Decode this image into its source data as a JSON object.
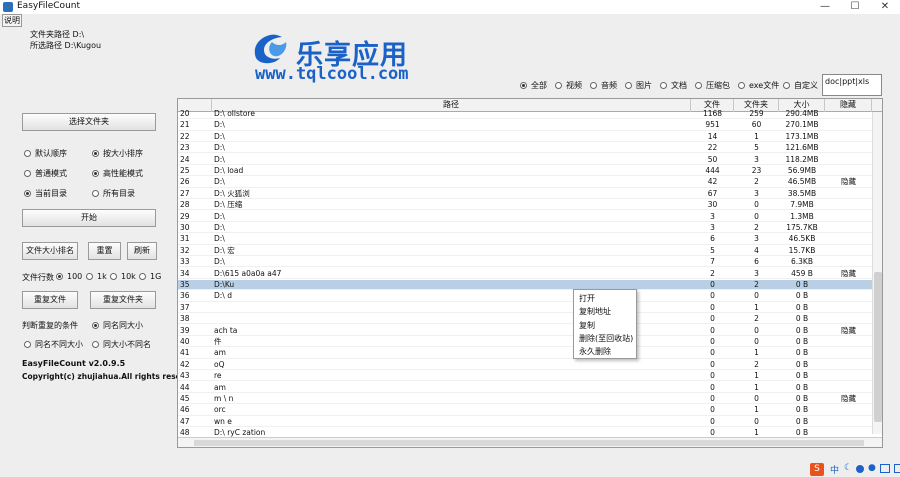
{
  "window": {
    "title": "EasyFileCount",
    "minimize": "—",
    "maximize": "☐",
    "close": "✕"
  },
  "help_button": "说明",
  "info": {
    "folder_path": "文件夹路径 D:\\",
    "selected_path": "所选路径 D:\\Kugou"
  },
  "watermark": {
    "name": "乐享应用",
    "url": "www.tqlcool.com"
  },
  "filters": {
    "options": [
      "全部",
      "视频",
      "音频",
      "图片",
      "文档",
      "压缩包",
      "exe文件",
      "自定义"
    ],
    "selected": "全部",
    "custom_ext": "doc|ppt|xls"
  },
  "left": {
    "select_folder": "选择文件夹",
    "sort_options": [
      "默认顺序",
      "按大小排序"
    ],
    "sort_selected": "按大小排序",
    "mode_options": [
      "普通模式",
      "高性能模式"
    ],
    "mode_selected": "高性能模式",
    "dir_options": [
      "当前目录",
      "所有目录"
    ],
    "dir_selected": "当前目录",
    "start": "开始",
    "rank": "文件大小排名",
    "reset": "重置",
    "refresh": "刷新",
    "rows_label": "文件行数",
    "rows_options": [
      "100",
      "1k",
      "10k",
      "1G"
    ],
    "rows_selected": "100",
    "dup_files": "重复文件",
    "dup_folders": "重复文件夹",
    "dup_cond_label": "判断重复的条件",
    "dup_options": [
      "同名同大小",
      "同名不同大小",
      "同大小不同名"
    ],
    "dup_selected": "同名同大小",
    "version": "EasyFileCount v2.0.9.5",
    "copyright": "Copyright(c) zhujiahua.All rights reserved."
  },
  "table": {
    "columns": [
      "",
      "路径",
      "文件",
      "文件夹",
      "大小",
      "隐藏"
    ],
    "rows": [
      {
        "n": "20",
        "path": "D:\\     ollstore",
        "files": "1168",
        "folders": "259",
        "size": "290.4MB",
        "hidden": ""
      },
      {
        "n": "21",
        "path": "D:\\",
        "files": "951",
        "folders": "60",
        "size": "270.1MB",
        "hidden": ""
      },
      {
        "n": "22",
        "path": "D:\\",
        "files": "14",
        "folders": "1",
        "size": "173.1MB",
        "hidden": ""
      },
      {
        "n": "23",
        "path": "D:\\",
        "files": "22",
        "folders": "5",
        "size": "121.6MB",
        "hidden": ""
      },
      {
        "n": "24",
        "path": "D:\\",
        "files": "50",
        "folders": "3",
        "size": "118.2MB",
        "hidden": ""
      },
      {
        "n": "25",
        "path": "D:\\                  load",
        "files": "444",
        "folders": "23",
        "size": "56.9MB",
        "hidden": ""
      },
      {
        "n": "26",
        "path": "D:\\",
        "files": "42",
        "folders": "2",
        "size": "46.5MB",
        "hidden": "隐藏"
      },
      {
        "n": "27",
        "path": "D:\\          火狐浏",
        "files": "67",
        "folders": "3",
        "size": "38.5MB",
        "hidden": ""
      },
      {
        "n": "28",
        "path": "D:\\          压缩",
        "files": "30",
        "folders": "0",
        "size": "7.9MB",
        "hidden": ""
      },
      {
        "n": "29",
        "path": "D:\\",
        "files": "3",
        "folders": "0",
        "size": "1.3MB",
        "hidden": ""
      },
      {
        "n": "30",
        "path": "D:\\",
        "files": "3",
        "folders": "2",
        "size": "175.7KB",
        "hidden": ""
      },
      {
        "n": "31",
        "path": "D:\\",
        "files": "6",
        "folders": "3",
        "size": "46.5KB",
        "hidden": ""
      },
      {
        "n": "32",
        "path": "D:\\          宏",
        "files": "5",
        "folders": "4",
        "size": "15.7KB",
        "hidden": ""
      },
      {
        "n": "33",
        "path": "D:\\",
        "files": "7",
        "folders": "6",
        "size": "6.3KB",
        "hidden": ""
      },
      {
        "n": "34",
        "path": "D:\\615        a0a0a               a47",
        "files": "2",
        "folders": "3",
        "size": "459 B",
        "hidden": "隐藏"
      },
      {
        "n": "35",
        "path": "D:\\Ku",
        "files": "0",
        "folders": "2",
        "size": "0 B",
        "hidden": "",
        "sel": true
      },
      {
        "n": "36",
        "path": "D:\\          d",
        "files": "0",
        "folders": "0",
        "size": "0 B",
        "hidden": ""
      },
      {
        "n": "37",
        "path": "",
        "files": "0",
        "folders": "1",
        "size": "0 B",
        "hidden": ""
      },
      {
        "n": "38",
        "path": "",
        "files": "0",
        "folders": "2",
        "size": "0 B",
        "hidden": ""
      },
      {
        "n": "39",
        "path": "           ach        ta",
        "files": "0",
        "folders": "0",
        "size": "0 B",
        "hidden": "隐藏"
      },
      {
        "n": "40",
        "path": "           件",
        "files": "0",
        "folders": "0",
        "size": "0 B",
        "hidden": ""
      },
      {
        "n": "41",
        "path": "           am",
        "files": "0",
        "folders": "1",
        "size": "0 B",
        "hidden": ""
      },
      {
        "n": "42",
        "path": "           oQ",
        "files": "0",
        "folders": "2",
        "size": "0 B",
        "hidden": ""
      },
      {
        "n": "43",
        "path": "           re",
        "files": "0",
        "folders": "1",
        "size": "0 B",
        "hidden": ""
      },
      {
        "n": "44",
        "path": "           am",
        "files": "0",
        "folders": "1",
        "size": "0 B",
        "hidden": ""
      },
      {
        "n": "45",
        "path": "           m \\             n",
        "files": "0",
        "folders": "0",
        "size": "0 B",
        "hidden": "隐藏"
      },
      {
        "n": "46",
        "path": "           orc",
        "files": "0",
        "folders": "1",
        "size": "0 B",
        "hidden": ""
      },
      {
        "n": "47",
        "path": "           wn           e",
        "files": "0",
        "folders": "0",
        "size": "0 B",
        "hidden": ""
      },
      {
        "n": "48",
        "path": "D:\\         ryC        zation",
        "files": "0",
        "folders": "1",
        "size": "0 B",
        "hidden": ""
      }
    ]
  },
  "context_menu": [
    "打开",
    "复制地址",
    "复制",
    "删除(至回收站)",
    "永久删除"
  ],
  "colors": {
    "accent": "#1a62c8",
    "selection": "#b8cfe5"
  },
  "tray": {
    "icons": [
      "input-method-icon",
      "ime-cn",
      "moon-icon",
      "dot-icon",
      "mic-icon",
      "keyboard-icon",
      "grid-icon"
    ],
    "ime_label": "中"
  }
}
